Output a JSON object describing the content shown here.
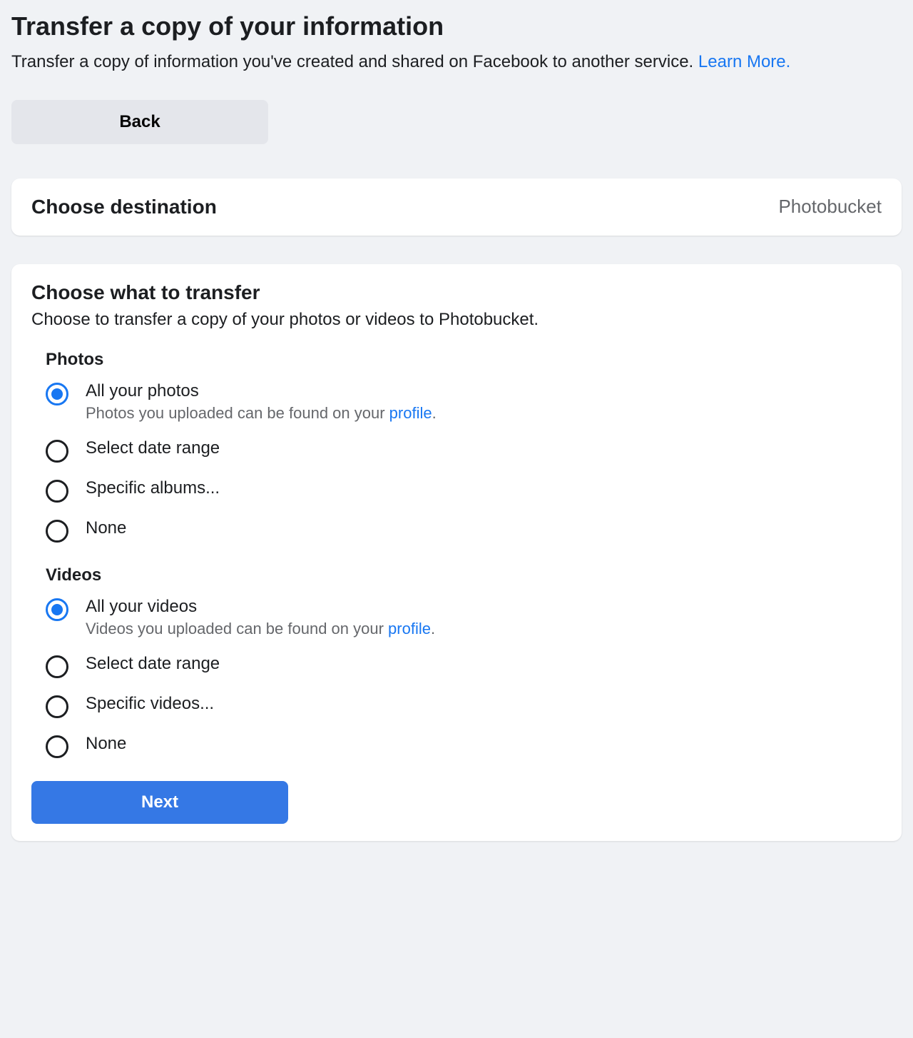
{
  "header": {
    "title": "Transfer a copy of your information",
    "subtitle_text": "Transfer a copy of information you've created and shared on Facebook to another service. ",
    "learn_more": "Learn More."
  },
  "buttons": {
    "back": "Back",
    "next": "Next"
  },
  "destination": {
    "label": "Choose destination",
    "value": "Photobucket"
  },
  "transfer": {
    "title": "Choose what to transfer",
    "subtitle": "Choose to transfer a copy of your photos or videos to Photobucket."
  },
  "photos": {
    "group_title": "Photos",
    "options": [
      {
        "label": "All your photos",
        "sub_prefix": "Photos you uploaded can be found on your ",
        "sub_link": "profile",
        "sub_suffix": ".",
        "selected": true
      },
      {
        "label": "Select date range",
        "selected": false
      },
      {
        "label": "Specific albums...",
        "selected": false
      },
      {
        "label": "None",
        "selected": false
      }
    ]
  },
  "videos": {
    "group_title": "Videos",
    "options": [
      {
        "label": "All your videos",
        "sub_prefix": "Videos you uploaded can be found on your ",
        "sub_link": "profile",
        "sub_suffix": ".",
        "selected": true
      },
      {
        "label": "Select date range",
        "selected": false
      },
      {
        "label": "Specific videos...",
        "selected": false
      },
      {
        "label": "None",
        "selected": false
      }
    ]
  }
}
